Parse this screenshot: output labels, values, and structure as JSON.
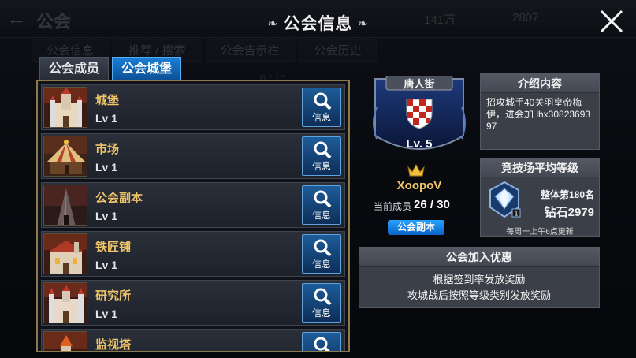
{
  "background": {
    "header_title": "公会",
    "resource_1": "141万",
    "resource_2": "2807",
    "tabs": [
      "公会信息",
      "推荐 / 搜索",
      "公会告示栏",
      "公会历史"
    ],
    "member_count_text": "0 / 10"
  },
  "dialog": {
    "title": "公会信息"
  },
  "tabs": [
    {
      "label": "公会成员",
      "active": false
    },
    {
      "label": "公会城堡",
      "active": true
    }
  ],
  "buildings": [
    {
      "name": "城堡",
      "level": "Lv 1",
      "button": "信息",
      "icon": "castle-thumbnail"
    },
    {
      "name": "市场",
      "level": "Lv 1",
      "button": "信息",
      "icon": "market-tent-thumbnail"
    },
    {
      "name": "公会副本",
      "level": "Lv 1",
      "button": "信息",
      "icon": "dungeon-tower-thumbnail"
    },
    {
      "name": "铁匠铺",
      "level": "Lv 1",
      "button": "信息",
      "icon": "blacksmith-thumbnail"
    },
    {
      "name": "研究所",
      "level": "Lv 1",
      "button": "信息",
      "icon": "research-institute-thumbnail"
    },
    {
      "name": "监视塔",
      "level": "",
      "button": "信息",
      "icon": "watchtower-thumbnail"
    }
  ],
  "guild": {
    "name": "唐人街",
    "level": "Lv. 5",
    "leader": "XoopoV",
    "members_label": "当前成员",
    "members_value": "26 / 30",
    "raid_badge": "公会副本"
  },
  "intro": {
    "title": "介绍内容",
    "text": "招攻城手40关羽皇帝梅伊，进会加 lhx3082369397"
  },
  "arena": {
    "title": "竞技场平均等级",
    "rank": "整体第180名",
    "tier": "钻石2979",
    "note": "每周一上午6点更新",
    "badge_number": "1"
  },
  "benefits": {
    "title": "公会加入优惠",
    "lines": [
      "根据签到率发放奖励",
      "攻城战后按照等级类别发放奖励"
    ]
  },
  "colors": {
    "gold_text": "#f0c56a",
    "active_tab": "#1b7fd6",
    "info_button": "#1d5c9a",
    "frame_gold": "#8c7a4a"
  }
}
